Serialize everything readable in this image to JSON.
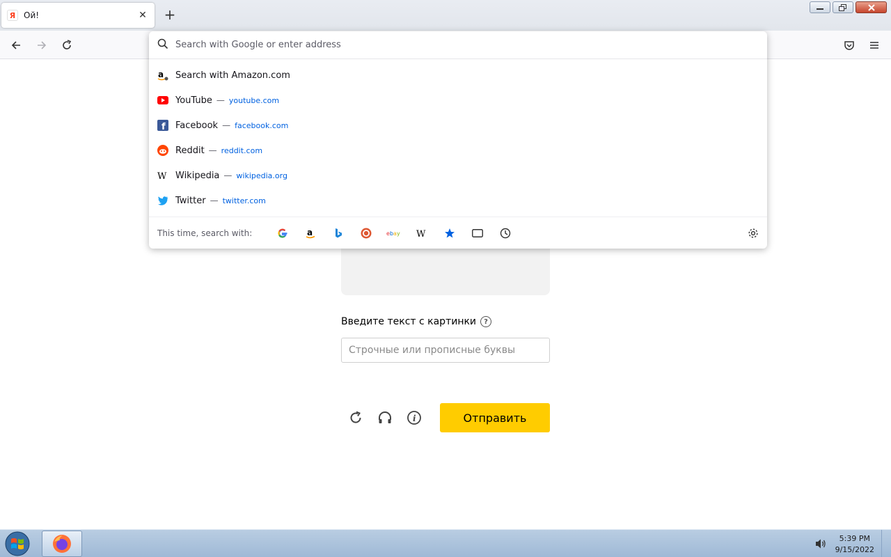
{
  "browser": {
    "tab": {
      "title": "Ой!",
      "favicon_letter": "Я"
    },
    "urlbar": {
      "placeholder": "Search with Google or enter address",
      "results": [
        {
          "title": "Search with Amazon.com",
          "url": "",
          "icon": "amazon-icon"
        },
        {
          "title": "YouTube",
          "url": "youtube.com",
          "icon": "youtube-icon"
        },
        {
          "title": "Facebook",
          "url": "facebook.com",
          "icon": "facebook-icon"
        },
        {
          "title": "Reddit",
          "url": "reddit.com",
          "icon": "reddit-icon"
        },
        {
          "title": "Wikipedia",
          "url": "wikipedia.org",
          "icon": "wikipedia-icon"
        },
        {
          "title": "Twitter",
          "url": "twitter.com",
          "icon": "twitter-icon"
        }
      ],
      "separator": "—",
      "oneoff_label": "This time, search with:",
      "engines": [
        "google-icon",
        "amazon-icon",
        "bing-icon",
        "duckduckgo-icon",
        "ebay-icon",
        "wikipedia-icon",
        "bookmarks-icon",
        "tabs-icon",
        "history-icon"
      ]
    }
  },
  "page": {
    "captcha_label": "Введите текст с картинки",
    "input_placeholder": "Строчные или прописные буквы",
    "submit_label": "Отправить",
    "help_glyph": "?"
  },
  "taskbar": {
    "time": "5:39 PM",
    "date": "9/15/2022"
  },
  "colors": {
    "submit_bg": "#ffcc00",
    "link": "#0061e0",
    "youtube": "#ff0000",
    "facebook": "#1877f2",
    "reddit": "#ff4500",
    "twitter": "#1da1f2"
  }
}
